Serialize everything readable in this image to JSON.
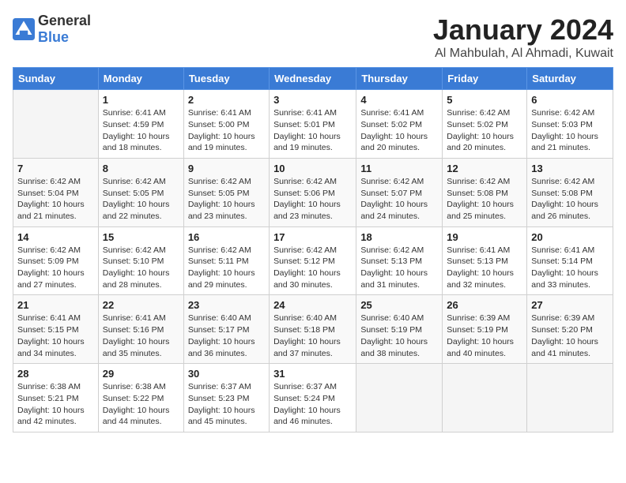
{
  "logo": {
    "text_general": "General",
    "text_blue": "Blue"
  },
  "title": "January 2024",
  "subtitle": "Al Mahbulah, Al Ahmadi, Kuwait",
  "header_days": [
    "Sunday",
    "Monday",
    "Tuesday",
    "Wednesday",
    "Thursday",
    "Friday",
    "Saturday"
  ],
  "weeks": [
    [
      {
        "day": "",
        "sunrise": "",
        "sunset": "",
        "daylight": ""
      },
      {
        "day": "1",
        "sunrise": "Sunrise: 6:41 AM",
        "sunset": "Sunset: 4:59 PM",
        "daylight": "Daylight: 10 hours and 18 minutes."
      },
      {
        "day": "2",
        "sunrise": "Sunrise: 6:41 AM",
        "sunset": "Sunset: 5:00 PM",
        "daylight": "Daylight: 10 hours and 19 minutes."
      },
      {
        "day": "3",
        "sunrise": "Sunrise: 6:41 AM",
        "sunset": "Sunset: 5:01 PM",
        "daylight": "Daylight: 10 hours and 19 minutes."
      },
      {
        "day": "4",
        "sunrise": "Sunrise: 6:41 AM",
        "sunset": "Sunset: 5:02 PM",
        "daylight": "Daylight: 10 hours and 20 minutes."
      },
      {
        "day": "5",
        "sunrise": "Sunrise: 6:42 AM",
        "sunset": "Sunset: 5:02 PM",
        "daylight": "Daylight: 10 hours and 20 minutes."
      },
      {
        "day": "6",
        "sunrise": "Sunrise: 6:42 AM",
        "sunset": "Sunset: 5:03 PM",
        "daylight": "Daylight: 10 hours and 21 minutes."
      }
    ],
    [
      {
        "day": "7",
        "sunrise": "Sunrise: 6:42 AM",
        "sunset": "Sunset: 5:04 PM",
        "daylight": "Daylight: 10 hours and 21 minutes."
      },
      {
        "day": "8",
        "sunrise": "Sunrise: 6:42 AM",
        "sunset": "Sunset: 5:05 PM",
        "daylight": "Daylight: 10 hours and 22 minutes."
      },
      {
        "day": "9",
        "sunrise": "Sunrise: 6:42 AM",
        "sunset": "Sunset: 5:05 PM",
        "daylight": "Daylight: 10 hours and 23 minutes."
      },
      {
        "day": "10",
        "sunrise": "Sunrise: 6:42 AM",
        "sunset": "Sunset: 5:06 PM",
        "daylight": "Daylight: 10 hours and 23 minutes."
      },
      {
        "day": "11",
        "sunrise": "Sunrise: 6:42 AM",
        "sunset": "Sunset: 5:07 PM",
        "daylight": "Daylight: 10 hours and 24 minutes."
      },
      {
        "day": "12",
        "sunrise": "Sunrise: 6:42 AM",
        "sunset": "Sunset: 5:08 PM",
        "daylight": "Daylight: 10 hours and 25 minutes."
      },
      {
        "day": "13",
        "sunrise": "Sunrise: 6:42 AM",
        "sunset": "Sunset: 5:08 PM",
        "daylight": "Daylight: 10 hours and 26 minutes."
      }
    ],
    [
      {
        "day": "14",
        "sunrise": "Sunrise: 6:42 AM",
        "sunset": "Sunset: 5:09 PM",
        "daylight": "Daylight: 10 hours and 27 minutes."
      },
      {
        "day": "15",
        "sunrise": "Sunrise: 6:42 AM",
        "sunset": "Sunset: 5:10 PM",
        "daylight": "Daylight: 10 hours and 28 minutes."
      },
      {
        "day": "16",
        "sunrise": "Sunrise: 6:42 AM",
        "sunset": "Sunset: 5:11 PM",
        "daylight": "Daylight: 10 hours and 29 minutes."
      },
      {
        "day": "17",
        "sunrise": "Sunrise: 6:42 AM",
        "sunset": "Sunset: 5:12 PM",
        "daylight": "Daylight: 10 hours and 30 minutes."
      },
      {
        "day": "18",
        "sunrise": "Sunrise: 6:42 AM",
        "sunset": "Sunset: 5:13 PM",
        "daylight": "Daylight: 10 hours and 31 minutes."
      },
      {
        "day": "19",
        "sunrise": "Sunrise: 6:41 AM",
        "sunset": "Sunset: 5:13 PM",
        "daylight": "Daylight: 10 hours and 32 minutes."
      },
      {
        "day": "20",
        "sunrise": "Sunrise: 6:41 AM",
        "sunset": "Sunset: 5:14 PM",
        "daylight": "Daylight: 10 hours and 33 minutes."
      }
    ],
    [
      {
        "day": "21",
        "sunrise": "Sunrise: 6:41 AM",
        "sunset": "Sunset: 5:15 PM",
        "daylight": "Daylight: 10 hours and 34 minutes."
      },
      {
        "day": "22",
        "sunrise": "Sunrise: 6:41 AM",
        "sunset": "Sunset: 5:16 PM",
        "daylight": "Daylight: 10 hours and 35 minutes."
      },
      {
        "day": "23",
        "sunrise": "Sunrise: 6:40 AM",
        "sunset": "Sunset: 5:17 PM",
        "daylight": "Daylight: 10 hours and 36 minutes."
      },
      {
        "day": "24",
        "sunrise": "Sunrise: 6:40 AM",
        "sunset": "Sunset: 5:18 PM",
        "daylight": "Daylight: 10 hours and 37 minutes."
      },
      {
        "day": "25",
        "sunrise": "Sunrise: 6:40 AM",
        "sunset": "Sunset: 5:19 PM",
        "daylight": "Daylight: 10 hours and 38 minutes."
      },
      {
        "day": "26",
        "sunrise": "Sunrise: 6:39 AM",
        "sunset": "Sunset: 5:19 PM",
        "daylight": "Daylight: 10 hours and 40 minutes."
      },
      {
        "day": "27",
        "sunrise": "Sunrise: 6:39 AM",
        "sunset": "Sunset: 5:20 PM",
        "daylight": "Daylight: 10 hours and 41 minutes."
      }
    ],
    [
      {
        "day": "28",
        "sunrise": "Sunrise: 6:38 AM",
        "sunset": "Sunset: 5:21 PM",
        "daylight": "Daylight: 10 hours and 42 minutes."
      },
      {
        "day": "29",
        "sunrise": "Sunrise: 6:38 AM",
        "sunset": "Sunset: 5:22 PM",
        "daylight": "Daylight: 10 hours and 44 minutes."
      },
      {
        "day": "30",
        "sunrise": "Sunrise: 6:37 AM",
        "sunset": "Sunset: 5:23 PM",
        "daylight": "Daylight: 10 hours and 45 minutes."
      },
      {
        "day": "31",
        "sunrise": "Sunrise: 6:37 AM",
        "sunset": "Sunset: 5:24 PM",
        "daylight": "Daylight: 10 hours and 46 minutes."
      },
      {
        "day": "",
        "sunrise": "",
        "sunset": "",
        "daylight": ""
      },
      {
        "day": "",
        "sunrise": "",
        "sunset": "",
        "daylight": ""
      },
      {
        "day": "",
        "sunrise": "",
        "sunset": "",
        "daylight": ""
      }
    ]
  ]
}
